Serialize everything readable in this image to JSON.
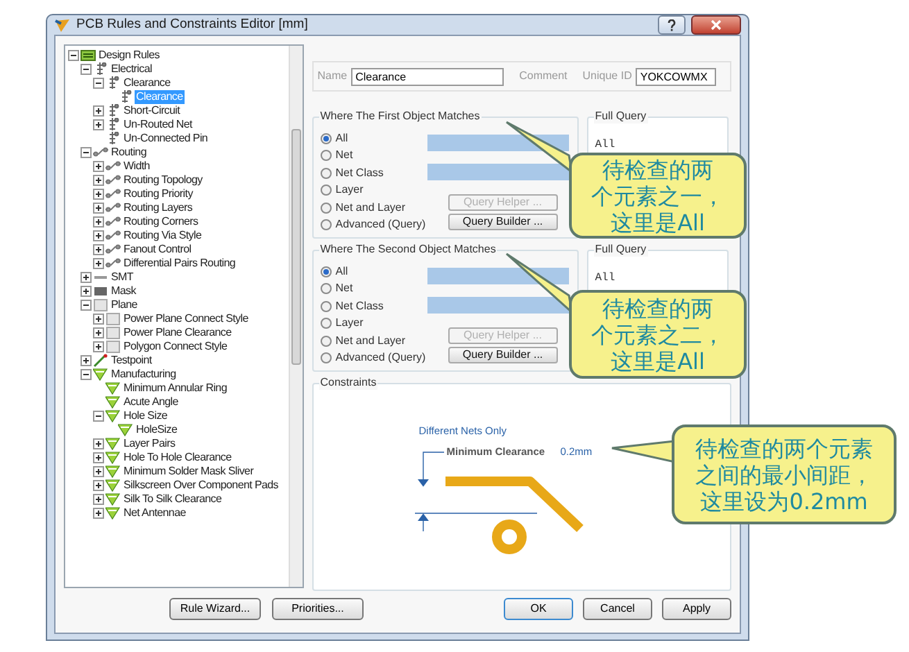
{
  "window": {
    "title": "PCB Rules and Constraints Editor [mm]"
  },
  "tree": [
    {
      "label": "Design Rules",
      "kind": "folder",
      "expanded": true,
      "selected": false,
      "children": [
        {
          "label": "Electrical",
          "kind": "electrical",
          "expanded": true,
          "selected": false,
          "children": [
            {
              "label": "Clearance",
              "kind": "electrical",
              "expanded": true,
              "selected": false,
              "children": [
                {
                  "label": "Clearance",
                  "kind": "electrical",
                  "selected": true
                }
              ]
            },
            {
              "label": "Short-Circuit",
              "kind": "electrical",
              "expanded": false,
              "selected": false
            },
            {
              "label": "Un-Routed Net",
              "kind": "electrical",
              "expanded": false,
              "selected": false
            },
            {
              "label": "Un-Connected Pin",
              "kind": "electrical",
              "selected": false
            }
          ]
        },
        {
          "label": "Routing",
          "kind": "routing",
          "expanded": true,
          "selected": false,
          "children": [
            {
              "label": "Width",
              "kind": "routing",
              "expanded": false,
              "selected": false
            },
            {
              "label": "Routing Topology",
              "kind": "routing",
              "expanded": false,
              "selected": false
            },
            {
              "label": "Routing Priority",
              "kind": "routing",
              "expanded": false,
              "selected": false
            },
            {
              "label": "Routing Layers",
              "kind": "routing",
              "expanded": false,
              "selected": false
            },
            {
              "label": "Routing Corners",
              "kind": "routing",
              "expanded": false,
              "selected": false
            },
            {
              "label": "Routing Via Style",
              "kind": "routing",
              "expanded": false,
              "selected": false
            },
            {
              "label": "Fanout Control",
              "kind": "routing",
              "expanded": false,
              "selected": false
            },
            {
              "label": "Differential Pairs Routing",
              "kind": "routing",
              "expanded": false,
              "selected": false
            }
          ]
        },
        {
          "label": "SMT",
          "kind": "smt",
          "expanded": false,
          "selected": false
        },
        {
          "label": "Mask",
          "kind": "mask",
          "expanded": false,
          "selected": false
        },
        {
          "label": "Plane",
          "kind": "plane",
          "expanded": true,
          "selected": false,
          "children": [
            {
              "label": "Power Plane Connect Style",
              "kind": "plane",
              "expanded": false,
              "selected": false
            },
            {
              "label": "Power Plane Clearance",
              "kind": "plane",
              "expanded": false,
              "selected": false
            },
            {
              "label": "Polygon Connect Style",
              "kind": "plane",
              "expanded": false,
              "selected": false
            }
          ]
        },
        {
          "label": "Testpoint",
          "kind": "testpoint",
          "expanded": false,
          "selected": false
        },
        {
          "label": "Manufacturing",
          "kind": "manufacturing",
          "expanded": true,
          "selected": false,
          "children": [
            {
              "label": "Minimum Annular Ring",
              "kind": "manufacturing",
              "selected": false
            },
            {
              "label": "Acute Angle",
              "kind": "manufacturing",
              "selected": false
            },
            {
              "label": "Hole Size",
              "kind": "manufacturing",
              "expanded": true,
              "selected": false,
              "children": [
                {
                  "label": "HoleSize",
                  "kind": "manufacturing",
                  "selected": false
                }
              ]
            },
            {
              "label": "Layer Pairs",
              "kind": "manufacturing",
              "expanded": false,
              "selected": false
            },
            {
              "label": "Hole To Hole Clearance",
              "kind": "manufacturing",
              "expanded": false,
              "selected": false
            },
            {
              "label": "Minimum Solder Mask Sliver",
              "kind": "manufacturing",
              "expanded": false,
              "selected": false
            },
            {
              "label": "Silkscreen Over Component Pads",
              "kind": "manufacturing",
              "expanded": false,
              "selected": false
            },
            {
              "label": "Silk To Silk Clearance",
              "kind": "manufacturing",
              "expanded": false,
              "selected": false
            },
            {
              "label": "Net Antennae",
              "kind": "manufacturing",
              "expanded": false,
              "selected": false
            }
          ]
        }
      ]
    }
  ],
  "rule": {
    "name_label": "Name",
    "name_value": "Clearance",
    "comment_label": "Comment",
    "unique_id_label": "Unique ID",
    "unique_id_value": "YOKCOWMX"
  },
  "matches": [
    {
      "title": "Where The First Object Matches",
      "options": [
        {
          "label": "All",
          "selected": true
        },
        {
          "label": "Net",
          "selected": false
        },
        {
          "label": "Net Class",
          "selected": false
        },
        {
          "label": "Layer",
          "selected": false
        },
        {
          "label": "Net and Layer",
          "selected": false
        },
        {
          "label": "Advanced (Query)",
          "selected": false
        }
      ],
      "query_helper": {
        "label": "Query Helper ...",
        "disabled": true
      },
      "query_builder": {
        "label": "Query Builder ...",
        "disabled": false
      },
      "full_query_title": "Full Query",
      "full_query": "All"
    },
    {
      "title": "Where The Second Object Matches",
      "options": [
        {
          "label": "All",
          "selected": true
        },
        {
          "label": "Net",
          "selected": false
        },
        {
          "label": "Net Class",
          "selected": false
        },
        {
          "label": "Layer",
          "selected": false
        },
        {
          "label": "Net and Layer",
          "selected": false
        },
        {
          "label": "Advanced (Query)",
          "selected": false
        }
      ],
      "query_helper": {
        "label": "Query Helper ...",
        "disabled": true
      },
      "query_builder": {
        "label": "Query Builder ...",
        "disabled": false
      },
      "full_query_title": "Full Query",
      "full_query": "All"
    }
  ],
  "constraints": {
    "title": "Constraints",
    "scope": "Different Nets Only",
    "min_label": "Minimum Clearance",
    "min_value": "0.2mm"
  },
  "buttons_left": [
    "Rule Wizard...",
    "Priorities..."
  ],
  "buttons_right": [
    "OK",
    "Cancel",
    "Apply"
  ],
  "callouts": [
    {
      "lines": [
        "待检查的两",
        "个元素之一，",
        "这里是All"
      ]
    },
    {
      "lines": [
        "待检查的两",
        "个元素之二，",
        "这里是All"
      ]
    },
    {
      "lines": [
        "待检查的两个元素",
        "之间的最小间距，",
        "这里设为0.2mm"
      ]
    }
  ]
}
